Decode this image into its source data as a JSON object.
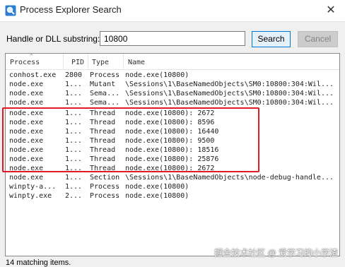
{
  "window": {
    "title": "Process Explorer Search",
    "close_glyph": "✕",
    "app_icon": "magnifier-search-icon"
  },
  "search": {
    "label": "Handle or DLL substring:",
    "value": "10800",
    "search_button": "Search",
    "cancel_button": "Cancel"
  },
  "list": {
    "columns": {
      "process": "Process",
      "pid": "PID",
      "type": "Type",
      "name": "Name"
    },
    "sort_indicator": "^",
    "rows": [
      {
        "process": "conhost.exe",
        "pid": "2800",
        "type": "Process",
        "name": "node.exe(10800)"
      },
      {
        "process": "node.exe",
        "pid": "1...",
        "type": "Mutant",
        "name": "\\Sessions\\1\\BaseNamedObjects\\SM0:10800:304:Wil..."
      },
      {
        "process": "node.exe",
        "pid": "1...",
        "type": "Sema...",
        "name": "\\Sessions\\1\\BaseNamedObjects\\SM0:10800:304:Wil..."
      },
      {
        "process": "node.exe",
        "pid": "1...",
        "type": "Sema...",
        "name": "\\Sessions\\1\\BaseNamedObjects\\SM0:10800:304:Wil..."
      },
      {
        "process": "node.exe",
        "pid": "1...",
        "type": "Thread",
        "name": "node.exe(10800): 2672"
      },
      {
        "process": "node.exe",
        "pid": "1...",
        "type": "Thread",
        "name": "node.exe(10800): 8596"
      },
      {
        "process": "node.exe",
        "pid": "1...",
        "type": "Thread",
        "name": "node.exe(10800): 16440"
      },
      {
        "process": "node.exe",
        "pid": "1...",
        "type": "Thread",
        "name": "node.exe(10800): 9500"
      },
      {
        "process": "node.exe",
        "pid": "1...",
        "type": "Thread",
        "name": "node.exe(10800): 18516"
      },
      {
        "process": "node.exe",
        "pid": "1...",
        "type": "Thread",
        "name": "node.exe(10800): 25876"
      },
      {
        "process": "node.exe",
        "pid": "1...",
        "type": "Thread",
        "name": "node.exe(10800): 2672"
      },
      {
        "process": "node.exe",
        "pid": "1...",
        "type": "Section",
        "name": "\\Sessions\\1\\BaseNamedObjects\\node-debug-handle..."
      },
      {
        "process": "winpty-a...",
        "pid": "1...",
        "type": "Process",
        "name": "node.exe(10800)"
      },
      {
        "process": "winpty.exe",
        "pid": "2...",
        "type": "Process",
        "name": "node.exe(10800)"
      }
    ]
  },
  "watermark": "掘金技术社区 @ 爱学习的小学渣",
  "status": "14 matching items."
}
